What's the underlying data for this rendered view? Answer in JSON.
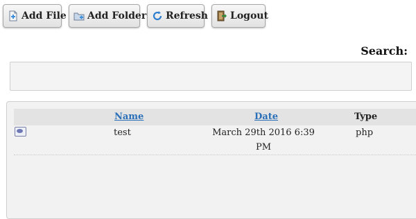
{
  "toolbar": {
    "add_file": {
      "label": "Add File",
      "icon": "add-file-icon"
    },
    "add_folder": {
      "label": "Add Folder",
      "icon": "add-folder-icon"
    },
    "refresh": {
      "label": "Refresh",
      "icon": "refresh-icon"
    },
    "logout": {
      "label": "Logout",
      "icon": "logout-icon"
    }
  },
  "search": {
    "label": "Search:",
    "value": "",
    "placeholder": ""
  },
  "table": {
    "columns": {
      "name": "Name",
      "date": "Date",
      "type": "Type"
    },
    "rows": [
      {
        "icon": "php-file-icon",
        "name": "test",
        "date": "March 29th 2016 6:39 PM",
        "type": "php"
      }
    ]
  },
  "colors": {
    "link": "#2a6fb7",
    "header_bg": "#e3e3e3",
    "panel_bg": "#f2f2f2"
  }
}
